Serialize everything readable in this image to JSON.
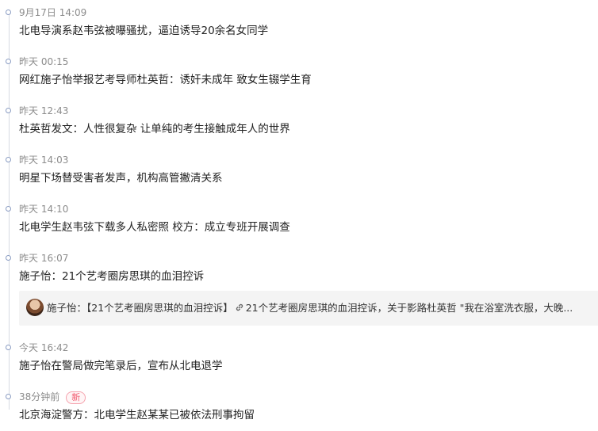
{
  "timeline": {
    "items": [
      {
        "time": "9月17日 14:09",
        "title": "北电导演系赵韦弦被曝骚扰，逼迫诱导20余名女同学"
      },
      {
        "time": "昨天 00:15",
        "title": "网红施子怡举报艺考导师杜英哲：诱奸未成年 致女生辍学生育"
      },
      {
        "time": "昨天 12:43",
        "title": "杜英哲发文：人性很复杂 让单纯的考生接触成年人的世界"
      },
      {
        "time": "昨天 14:03",
        "title": "明星下场替受害者发声，机构高管撇清关系"
      },
      {
        "time": "昨天 14:10",
        "title": "北电学生赵韦弦下载多人私密照 校方：成立专班开展调查"
      },
      {
        "time": "昨天 16:07",
        "title": "施子怡：21个艺考圈房思琪的血泪控诉"
      },
      {
        "time": "今天 16:42",
        "title": "施子怡在警局做完笔录后，宣布从北电退学"
      },
      {
        "time": "38分钟前",
        "title": "北京海淀警方：北电学生赵某某已被依法刑事拘留",
        "badge": "新"
      }
    ],
    "weibo_card": {
      "author": "施子怡：",
      "tag": "【21个艺考圈房思琪的血泪控诉】",
      "text": "21个艺考圈房思琪的血泪控诉，关于影路杜英哲 \"我在浴室洗衣服，大晚..."
    }
  },
  "colors": {
    "dot_border": "#8a9cc2",
    "line": "#d6dbe3",
    "time_text": "#8c8c8c",
    "title_text": "#222222",
    "badge": "#f05a6e"
  },
  "icons": [
    "timeline-dot-icon",
    "link-icon",
    "avatar"
  ]
}
